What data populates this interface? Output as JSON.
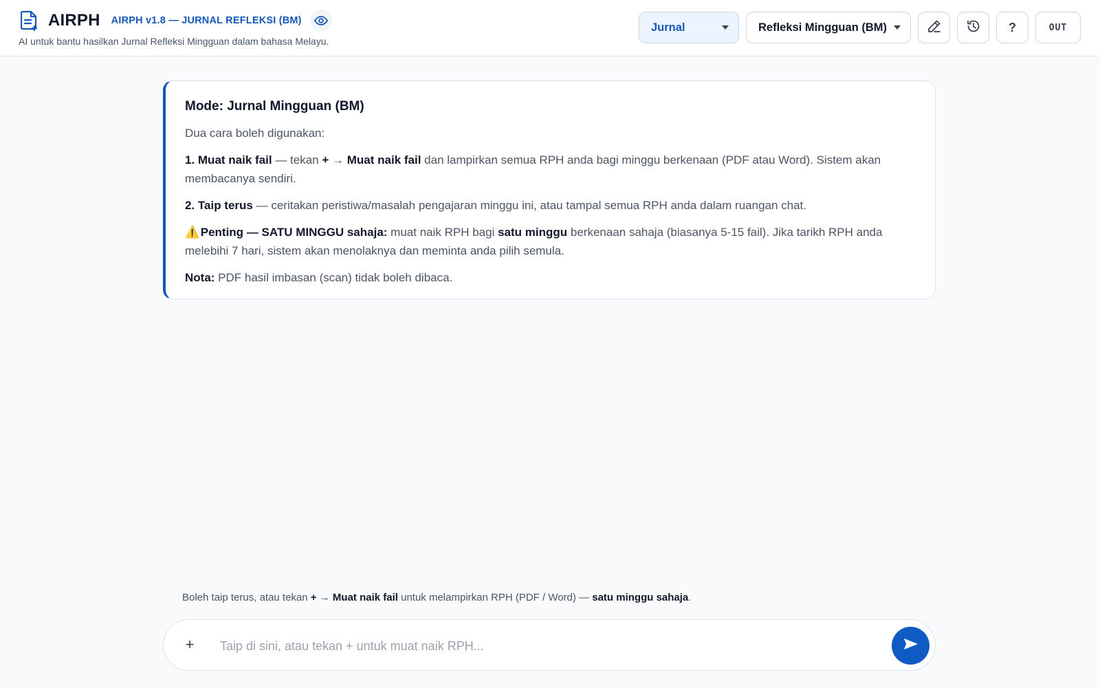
{
  "header": {
    "brand_name": "AIRPH",
    "version_label": "AIRPH v1.8 — JURNAL REFLEKSI (BM)",
    "subtitle": "AI untuk bantu hasilkan Jurnal Refleksi Mingguan dalam bahasa Melayu.",
    "brand_icon": "document-icon",
    "eye_icon": "eye-icon"
  },
  "controls": {
    "category_select": "Jurnal",
    "mode_select": "Refleksi Mingguan (BM)",
    "edit_icon": "pencil-icon",
    "history_icon": "history-icon",
    "help_label": "?",
    "logout_label": "OUT"
  },
  "card": {
    "title": "Mode: Jurnal Mingguan (BM)",
    "intro": "Dua cara boleh digunakan:",
    "step1_label": "1. Muat naik fail",
    "step1_a": " — tekan ",
    "step1_plus": "+",
    "step1_arrow": " → ",
    "step1_action": "Muat naik fail",
    "step1_b": " dan lampirkan semua RPH anda bagi minggu berkenaan (PDF atau Word). Sistem akan membacanya sendiri.",
    "step2_label": "2. Taip terus",
    "step2_text": " — ceritakan peristiwa/masalah pengajaran minggu ini, atau tampal semua RPH anda dalam ruangan chat.",
    "warn_icon": "⚠️",
    "warn_label": "Penting — SATU MINGGU sahaja:",
    "warn_a": " muat naik RPH bagi ",
    "warn_bold": "satu minggu",
    "warn_b": " berkenaan sahaja (biasanya 5-15 fail). Jika tarikh RPH anda melebihi 7 hari, sistem akan menolaknya dan meminta anda pilih semula.",
    "note_label": "Nota:",
    "note_text": " PDF hasil imbasan (scan) tidak boleh dibaca."
  },
  "hint": {
    "a": "Boleh taip terus, atau tekan ",
    "plus": "+",
    "arrow": " → ",
    "action": "Muat naik fail",
    "b": " untuk melampirkan RPH (PDF / Word) — ",
    "bold": "satu minggu sahaja",
    "c": "."
  },
  "composer": {
    "plus_label": "+",
    "placeholder": "Taip di sini, atau tekan + untuk muat naik RPH...",
    "value": "",
    "send_icon": "send-icon"
  },
  "colors": {
    "accent": "#1557b8",
    "send": "#0f5bc4",
    "background": "#f8fafc"
  }
}
